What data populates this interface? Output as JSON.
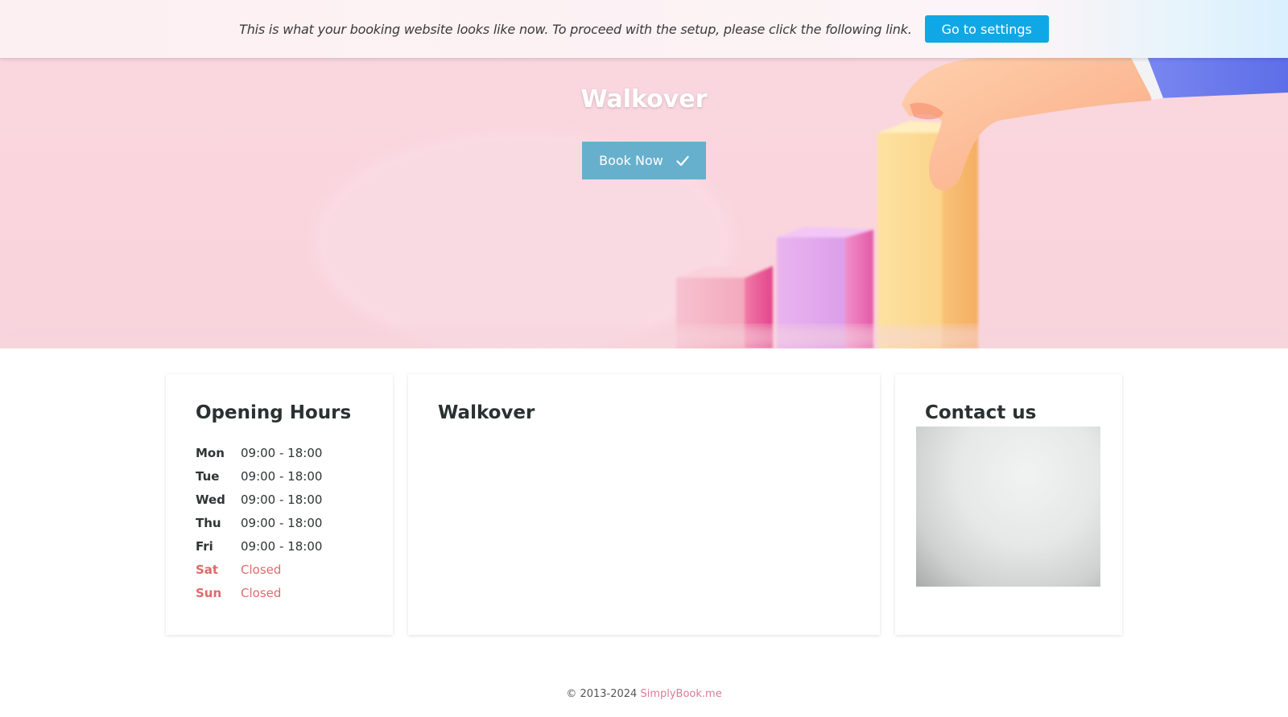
{
  "setup_banner": {
    "message": "This is what your booking website looks like now. To proceed with the setup, please click the following link.",
    "button_label": "Go to settings",
    "button_color": "#10a7e6"
  },
  "hero": {
    "title": "Walkover",
    "book_button_label": "Book Now",
    "book_button_color": "#67b0cd",
    "background_color": "#fad5dd"
  },
  "opening_hours": {
    "title": "Opening Hours",
    "rows": [
      {
        "day": "Mon",
        "hours": "09:00 - 18:00",
        "closed": false
      },
      {
        "day": "Tue",
        "hours": "09:00 - 18:00",
        "closed": false
      },
      {
        "day": "Wed",
        "hours": "09:00 - 18:00",
        "closed": false
      },
      {
        "day": "Thu",
        "hours": "09:00 - 18:00",
        "closed": false
      },
      {
        "day": "Fri",
        "hours": "09:00 - 18:00",
        "closed": false
      },
      {
        "day": "Sat",
        "hours": "Closed",
        "closed": true
      },
      {
        "day": "Sun",
        "hours": "Closed",
        "closed": true
      }
    ]
  },
  "about": {
    "title": "Walkover"
  },
  "contact": {
    "title": "Contact us"
  },
  "footer": {
    "copyright": "© 2013-2024",
    "link_label": "SimplyBook.me",
    "link_color": "#e07a95"
  },
  "icons": {
    "book_button": "check-icon"
  }
}
